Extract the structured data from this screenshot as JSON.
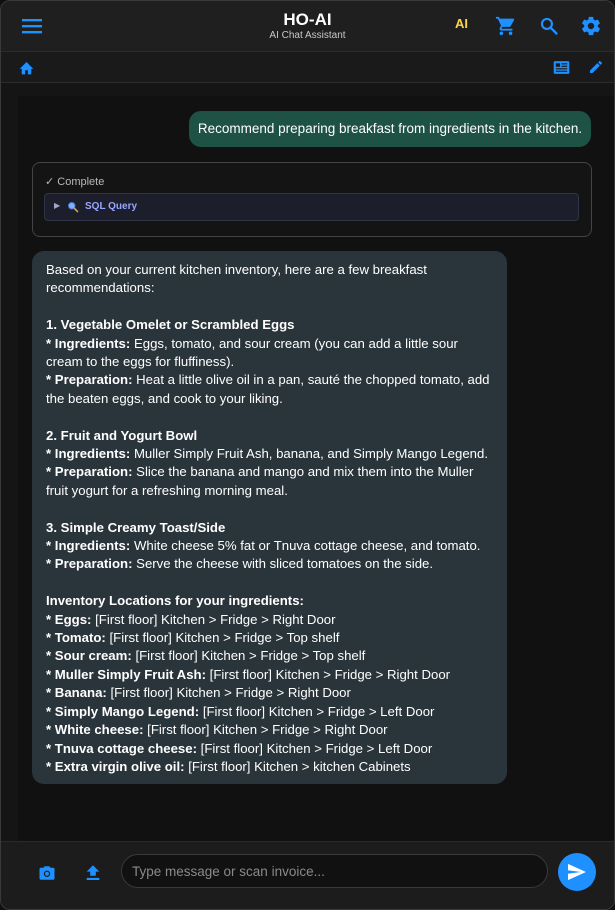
{
  "header": {
    "title": "HO-AI",
    "subtitle": "AI Chat Assistant",
    "ai_badge": "AI",
    "icons": [
      "menu-icon",
      "cart-icon",
      "search-icon",
      "gear-icon"
    ],
    "accent": "#1e90ff",
    "badge_color": "#ffd54a"
  },
  "subbar": {
    "icons": [
      "home-icon",
      "newspaper-icon",
      "edit-icon"
    ]
  },
  "chat": {
    "user_message": "Recommend preparing breakfast from ingredients in the kitchen.",
    "user_bubble_color": "#1d5244",
    "status": "✓ Complete",
    "tool_label": "SQL Query",
    "assistant_bubble_color": "#2a343b",
    "assistant": {
      "intro": "Based on your current kitchen inventory, here are a few breakfast recommendations:",
      "r1_title": "1. Vegetable Omelet or Scrambled Eggs",
      "r1_ing_label": "* Ingredients:",
      "r1_ing": "Eggs, tomato, and sour cream (you can add a little sour cream to the eggs for fluffiness).",
      "r1_prep_label": "* Preparation:",
      "r1_prep": "Heat a little olive oil in a pan, sauté the chopped tomato, add the beaten eggs, and cook to your liking.",
      "r2_title": "2. Fruit and Yogurt Bowl",
      "r2_ing_label": "* Ingredients:",
      "r2_ing": "Muller Simply Fruit Ash, banana, and Simply Mango Legend.",
      "r2_prep_label": "* Preparation:",
      "r2_prep": "Slice the banana and mango and mix them into the Muller fruit yogurt for a refreshing morning meal.",
      "r3_title": "3. Simple Creamy Toast/Side",
      "r3_ing_label": "* Ingredients:",
      "r3_ing": "White cheese 5% fat or Tnuva cottage cheese, and tomato.",
      "r3_prep_label": "* Preparation:",
      "r3_prep": "Serve the cheese with sliced tomatoes on the side.",
      "locations_title": "Inventory Locations for your ingredients:",
      "locations": [
        {
          "label": "* Eggs:",
          "value": "[First floor] Kitchen > Fridge > Right Door"
        },
        {
          "label": "* Tomato:",
          "value": "[First floor] Kitchen > Fridge > Top shelf"
        },
        {
          "label": "* Sour cream:",
          "value": "[First floor] Kitchen > Fridge > Top shelf"
        },
        {
          "label": "* Muller Simply Fruit Ash:",
          "value": "[First floor] Kitchen > Fridge > Right Door"
        },
        {
          "label": "* Banana:",
          "value": "[First floor] Kitchen > Fridge > Right Door"
        },
        {
          "label": "* Simply Mango Legend:",
          "value": "[First floor] Kitchen > Fridge > Left Door"
        },
        {
          "label": "* White cheese:",
          "value": "[First floor] Kitchen > Fridge > Right Door"
        },
        {
          "label": "* Tnuva cottage cheese:",
          "value": "[First floor] Kitchen > Fridge > Left Door"
        },
        {
          "label": "* Extra virgin olive oil:",
          "value": "[First floor] Kitchen > kitchen Cabinets"
        }
      ]
    }
  },
  "input": {
    "placeholder": "Type message or scan invoice...",
    "value": "",
    "icons": [
      "camera-icon",
      "upload-icon",
      "send-icon"
    ]
  }
}
